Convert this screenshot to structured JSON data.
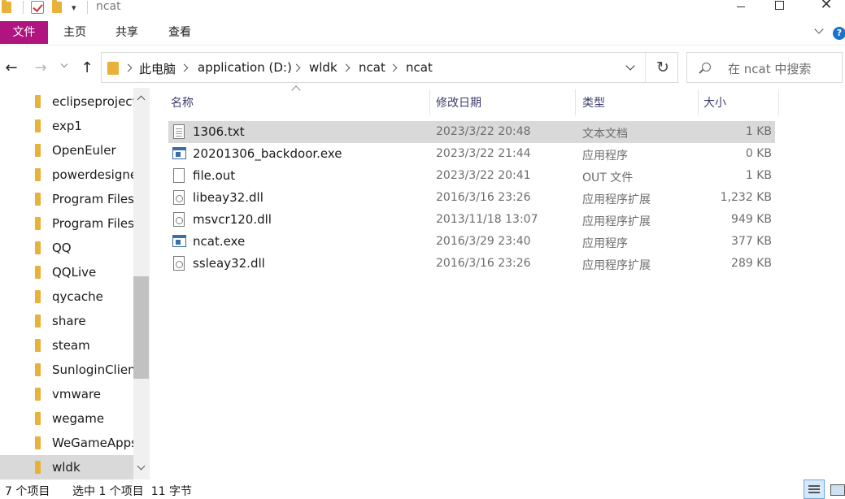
{
  "window": {
    "title": "ncat",
    "qat_dropdown_glyph": "▾",
    "close_glyph": "✕"
  },
  "ribbon": {
    "tabs": [
      "文件",
      "主页",
      "共享",
      "查看"
    ],
    "help_glyph": "?"
  },
  "nav": {
    "back_glyph": "←",
    "forward_glyph": "→",
    "up_glyph": "↑",
    "refresh_glyph": "↻"
  },
  "address": {
    "crumbs": [
      "此电脑",
      "application (D:)",
      "wldk",
      "ncat",
      "ncat"
    ]
  },
  "search": {
    "placeholder": "在 ncat 中搜索"
  },
  "sidebar": {
    "items": [
      {
        "label": "eclipseproject",
        "selected": false
      },
      {
        "label": "exp1",
        "selected": false
      },
      {
        "label": "OpenEuler",
        "selected": false
      },
      {
        "label": "powerdesigner",
        "selected": false
      },
      {
        "label": "Program Files",
        "selected": false
      },
      {
        "label": "Program Files",
        "selected": false
      },
      {
        "label": "QQ",
        "selected": false
      },
      {
        "label": "QQLive",
        "selected": false
      },
      {
        "label": "qycache",
        "selected": false
      },
      {
        "label": "share",
        "selected": false
      },
      {
        "label": "steam",
        "selected": false
      },
      {
        "label": "SunloginClient",
        "selected": false
      },
      {
        "label": "vmware",
        "selected": false
      },
      {
        "label": "wegame",
        "selected": false
      },
      {
        "label": "WeGameApps",
        "selected": false
      },
      {
        "label": "wldk",
        "selected": true
      }
    ]
  },
  "columns": {
    "name": "名称",
    "modified": "修改日期",
    "type": "类型",
    "size": "大小"
  },
  "files": [
    {
      "name": "1306.txt",
      "modified": "2023/3/22 20:48",
      "type": "文本文档",
      "size": "1 KB",
      "icon": "text-file-icon",
      "selected": true
    },
    {
      "name": "20201306_backdoor.exe",
      "modified": "2023/3/22 21:44",
      "type": "应用程序",
      "size": "0 KB",
      "icon": "exe-file-icon",
      "selected": false
    },
    {
      "name": "file.out",
      "modified": "2023/3/22 20:41",
      "type": "OUT 文件",
      "size": "1 KB",
      "icon": "blank-file-icon",
      "selected": false
    },
    {
      "name": "libeay32.dll",
      "modified": "2016/3/16 23:26",
      "type": "应用程序扩展",
      "size": "1,232 KB",
      "icon": "dll-file-icon",
      "selected": false
    },
    {
      "name": "msvcr120.dll",
      "modified": "2013/11/18 13:07",
      "type": "应用程序扩展",
      "size": "949 KB",
      "icon": "dll-file-icon",
      "selected": false
    },
    {
      "name": "ncat.exe",
      "modified": "2016/3/29 23:40",
      "type": "应用程序",
      "size": "377 KB",
      "icon": "exe-file-icon",
      "selected": false
    },
    {
      "name": "ssleay32.dll",
      "modified": "2016/3/16 23:26",
      "type": "应用程序扩展",
      "size": "289 KB",
      "icon": "dll-file-icon",
      "selected": false
    }
  ],
  "status": {
    "item_count": "7 个项目",
    "selection": "选中 1 个项目  11 字节"
  },
  "colors": {
    "file_tab": "#b0147f",
    "selection": "#d9d9d9",
    "folder": "#e8b23a"
  }
}
